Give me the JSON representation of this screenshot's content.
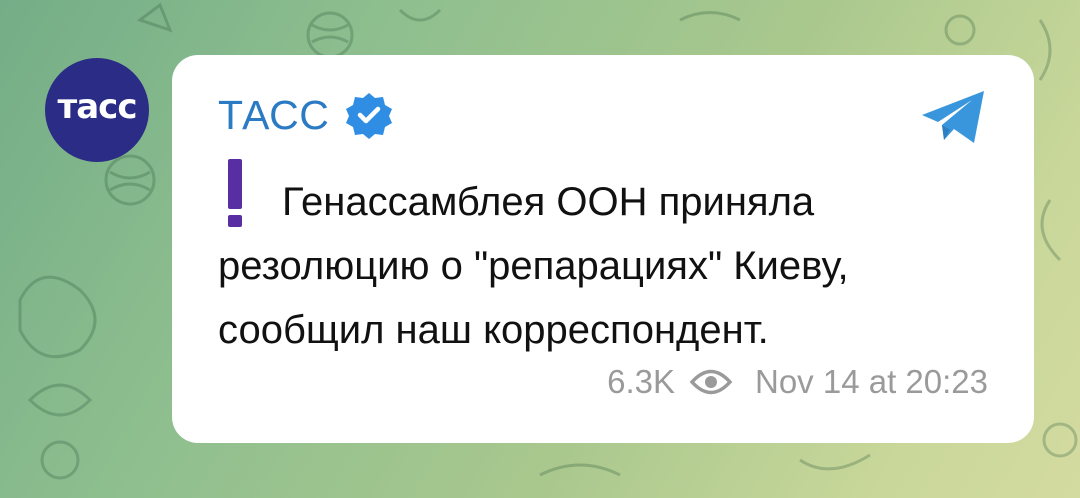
{
  "channel": {
    "avatar_text": "тасс",
    "name": "ТАСС",
    "verified_icon": "verified-badge-icon",
    "share_icon": "telegram-share-icon"
  },
  "post": {
    "emoji": "exclamation-mark-icon",
    "text": "Генассамблея ООН приняла резолюцию о \"репарациях\" Киеву, сообщил наш корреспондент.",
    "views": "6.3K",
    "views_icon": "eye-icon",
    "date": "Nov 14 at 20:23"
  },
  "colors": {
    "avatar_bg": "#2b2c86",
    "channel_name": "#2a7bc4",
    "verified": "#2f8ee3",
    "share": "#3a96dc",
    "exclamation": "#5a2ea3",
    "meta_text": "#9a9a9a"
  }
}
